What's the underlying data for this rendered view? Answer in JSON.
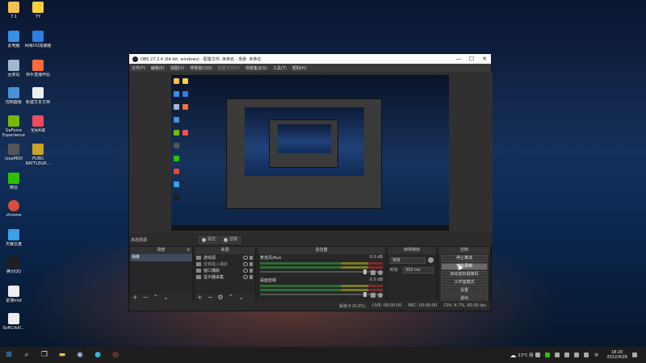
{
  "desktop_icons": [
    {
      "label": "7.1",
      "color": "#f2c14e"
    },
    {
      "label": "YY",
      "color": "#f5d142"
    },
    {
      "label": "此电脑",
      "color": "#3a8ee6"
    },
    {
      "label": "网易UU加速器",
      "color": "#2f7de1"
    },
    {
      "label": "回收站",
      "color": "#9fb7cf"
    },
    {
      "label": "快手直播伴侣",
      "color": "#ff6a3d"
    },
    {
      "label": "控制面板",
      "color": "#4a90d9"
    },
    {
      "label": "新建文本文档",
      "color": "#eeeeee"
    },
    {
      "label": "GeForce Experience",
      "color": "#76b900"
    },
    {
      "label": "全民K歌",
      "color": "#f24a5a"
    },
    {
      "label": "loopMIDI",
      "color": "#555555"
    },
    {
      "label": "PUBG BATTLEGR...",
      "color": "#c9a227"
    },
    {
      "label": "微信",
      "color": "#2dc100"
    },
    {
      "label": "chrome",
      "color": "#dd4b39"
    },
    {
      "label": "天翼云盘",
      "color": "#3aa0e8"
    },
    {
      "label": "腾讯QQ",
      "color": "#1f1f1f"
    },
    {
      "label": "苗墙mid",
      "color": "#eeeeee"
    },
    {
      "label": "SoftCrkill...",
      "color": "#eeeeee"
    }
  ],
  "obs": {
    "title": "OBS 27.2.4 (64-bit, windows) - 配置文件: 未命名 - 场景: 未命名",
    "window_controls": [
      "—",
      "☐",
      "✕"
    ],
    "menu": [
      "文件(F)",
      "编辑(E)",
      "视图(V)",
      "停靠窗口(D)",
      "配置文件(P)",
      "场景集合(S)",
      "工具(T)",
      "帮助(H)"
    ],
    "source_bar": {
      "selected": "未选择源",
      "props": "属性",
      "filters": "滤镜"
    },
    "scenes": {
      "title": "场景",
      "items": [
        "场景"
      ]
    },
    "sources": {
      "title": "来源",
      "items": [
        "游戏源",
        "音频输入捕获",
        "窗口捕获",
        "显示器采集"
      ]
    },
    "mixer": {
      "title": "混音器",
      "channels": [
        {
          "name": "麦克风/Aux",
          "db": "0.0 dB"
        },
        {
          "name": "桌面音频",
          "db": "0.0 dB"
        }
      ]
    },
    "transitions": {
      "title": "转场特效",
      "type": "渐变",
      "duration_label": "时长",
      "duration": "300 ms"
    },
    "controls": {
      "title": "控制",
      "buttons": [
        "停止推流",
        "开始录制",
        "启动虚拟摄像机",
        "工作室模式",
        "设置",
        "退出"
      ],
      "active_index": 1
    },
    "status": {
      "drop": "丢帧 0 (0.0%)",
      "live": "LIVE: 00:00:00",
      "rec": "REC: 00:00:00",
      "cpu": "CPU: 4.7%, 60.00 fps"
    }
  },
  "taskbar": {
    "weather": "23°C 阴",
    "lang": "中",
    "time": "18:20",
    "date": "2022/4/26"
  }
}
